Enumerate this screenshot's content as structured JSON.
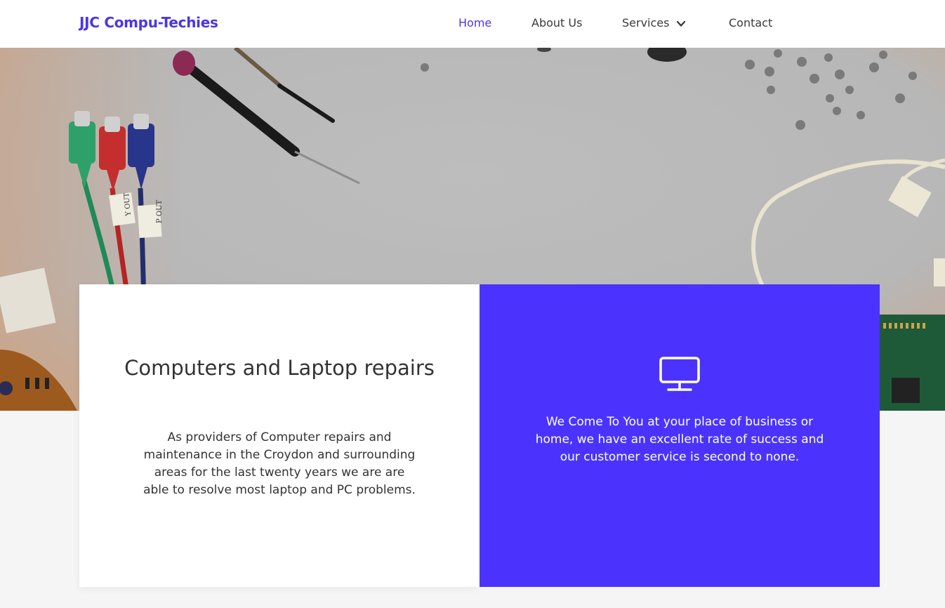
{
  "header": {
    "brand": "JJC Compu-Techies",
    "nav": [
      {
        "label": "Home",
        "active": true
      },
      {
        "label": "About Us"
      },
      {
        "label": "Services",
        "has_dropdown": true
      },
      {
        "label": "Contact"
      }
    ]
  },
  "hero": {
    "cable_labels": [
      "Y OUT",
      "P OUT"
    ]
  },
  "features": {
    "left": {
      "title": "Computers and Laptop repairs",
      "body": "As providers of Computer repairs and maintenance in the Croydon and surrounding areas for the last twenty years we are are able to resolve most laptop and PC problems."
    },
    "right": {
      "icon": "monitor-icon",
      "body": "We Come To You at your place of business or home, we have an excellent rate of success and our customer service is second to none."
    }
  },
  "colors": {
    "accent": "#4b33fd",
    "brand_text": "#4a36e8",
    "text": "#333333",
    "page_bg": "#f5f5f6"
  }
}
